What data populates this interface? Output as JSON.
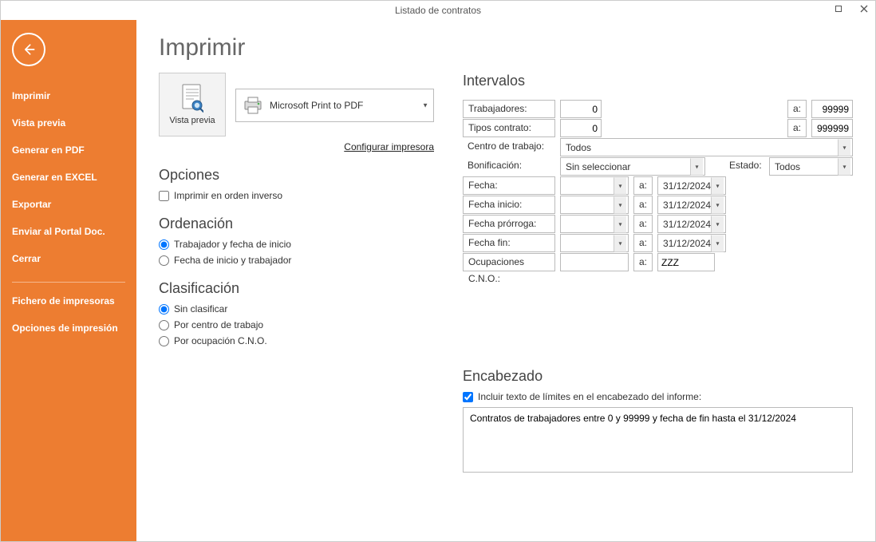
{
  "window": {
    "title": "Listado de contratos"
  },
  "sidebar": {
    "items": [
      {
        "label": "Imprimir",
        "name": "sidebar-item-imprimir"
      },
      {
        "label": "Vista previa",
        "name": "sidebar-item-vista-previa"
      },
      {
        "label": "Generar en PDF",
        "name": "sidebar-item-generar-pdf"
      },
      {
        "label": "Generar en EXCEL",
        "name": "sidebar-item-generar-excel"
      },
      {
        "label": "Exportar",
        "name": "sidebar-item-exportar"
      },
      {
        "label": "Enviar al Portal Doc.",
        "name": "sidebar-item-enviar-portal"
      },
      {
        "label": "Cerrar",
        "name": "sidebar-item-cerrar"
      }
    ],
    "items2": [
      {
        "label": "Fichero de impresoras",
        "name": "sidebar-item-fichero-impresoras"
      },
      {
        "label": "Opciones de impresión",
        "name": "sidebar-item-opciones-impresion"
      }
    ]
  },
  "page": {
    "title": "Imprimir",
    "preview_label": "Vista previa",
    "printer_name": "Microsoft Print to PDF",
    "configure_link": "Configurar impresora"
  },
  "opciones": {
    "heading": "Opciones",
    "reverse_label": "Imprimir en orden inverso",
    "reverse_checked": false
  },
  "ordenacion": {
    "heading": "Ordenación",
    "r1_label": "Trabajador y fecha de inicio",
    "r2_label": "Fecha de inicio y trabajador",
    "selected": "r1"
  },
  "clasificacion": {
    "heading": "Clasificación",
    "r1_label": "Sin clasificar",
    "r2_label": "Por centro de trabajo",
    "r3_label": "Por ocupación C.N.O.",
    "selected": "r1"
  },
  "intervalos": {
    "heading": "Intervalos",
    "trabajadores_label": "Trabajadores:",
    "trabajadores_from": "0",
    "trabajadores_to": "99999",
    "tipos_label": "Tipos contrato:",
    "tipos_from": "0",
    "tipos_to": "999999",
    "centro_label": "Centro de trabajo:",
    "centro_value": "Todos",
    "bonif_label": "Bonificación:",
    "bonif_value": "Sin seleccionar",
    "estado_label": "Estado:",
    "estado_value": "Todos",
    "fecha_label": "Fecha:",
    "fecha_from": "",
    "fecha_to": "31/12/2024",
    "finicio_label": "Fecha inicio:",
    "finicio_from": "",
    "finicio_to": "31/12/2024",
    "fprorroga_label": "Fecha prórroga:",
    "fprorroga_from": "",
    "fprorroga_to": "31/12/2024",
    "ffin_label": "Fecha fin:",
    "ffin_from": "",
    "ffin_to": "31/12/2024",
    "ocup_label": "Ocupaciones C.N.O.:",
    "ocup_from": "",
    "ocup_to": "ZZZ",
    "a_label": "a:"
  },
  "encabezado": {
    "heading": "Encabezado",
    "chk_label": "Incluir texto de límites en el encabezado del informe:",
    "chk_checked": true,
    "text": "Contratos de trabajadores entre 0 y 99999 y fecha de fin hasta el 31/12/2024"
  }
}
